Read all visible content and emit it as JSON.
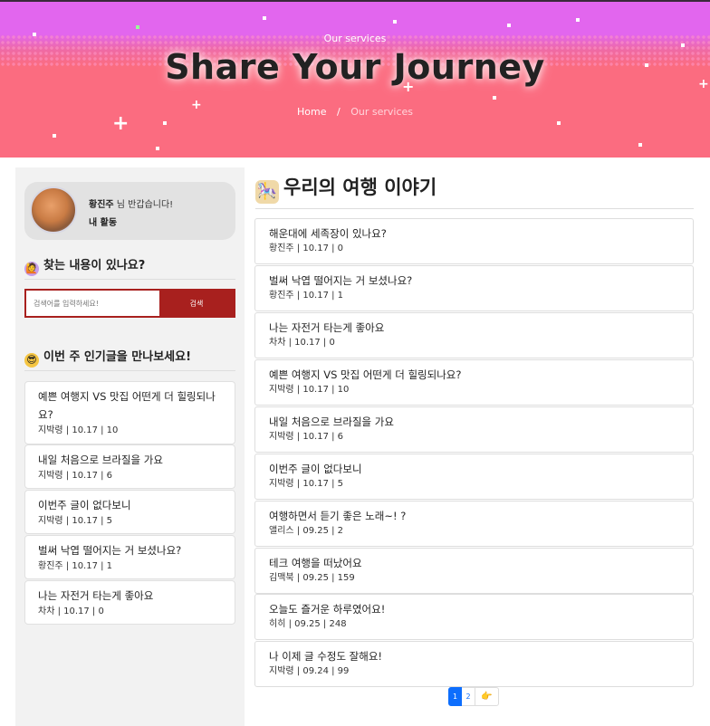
{
  "hero": {
    "eyebrow": "Our services",
    "title": "Share Your Journey",
    "breadcrumb_home": "Home",
    "breadcrumb_sep": "/",
    "breadcrumb_current": "Our services"
  },
  "profile": {
    "name": "황진주",
    "greeting_suffix": " 님 반갑습니다!",
    "activity_link": "내 활동"
  },
  "search": {
    "title": "찾는 내용이 있나요?",
    "placeholder": "검색어를 입력하세요!",
    "button": "검색"
  },
  "popular": {
    "title": "이번 주 인기글을 만나보세요!",
    "items": [
      {
        "title": "예쁜 여행지 VS 맛집 어떤게 더 힐링되나요?",
        "meta": "지박령 | 10.17 | 10"
      },
      {
        "title": "내일 처음으로 브라질을 가요",
        "meta": "지박령 | 10.17 | 6"
      },
      {
        "title": "이번주 글이 없다보니",
        "meta": "지박령 | 10.17 | 5"
      },
      {
        "title": "벌써 낙엽 떨어지는 거 보셨나요?",
        "meta": "황진주 | 10.17 | 1"
      },
      {
        "title": "나는 자전거 타는게 좋아요",
        "meta": "차차 | 10.17 | 0"
      }
    ]
  },
  "main": {
    "title": "우리의 여행 이야기",
    "posts": [
      {
        "title": "해운대에 세족장이 있나요?",
        "meta": "황진주 | 10.17 | 0"
      },
      {
        "title": "벌써 낙엽 떨어지는 거 보셨나요?",
        "meta": "황진주 | 10.17 | 1"
      },
      {
        "title": "나는 자전거 타는게 좋아요",
        "meta": "차차 | 10.17 | 0"
      },
      {
        "title": "예쁜 여행지 VS 맛집 어떤게 더 힐링되나요?",
        "meta": "지박령 | 10.17 | 10"
      },
      {
        "title": "내일 처음으로 브라질을 가요",
        "meta": "지박령 | 10.17 | 6"
      },
      {
        "title": "이번주 글이 없다보니",
        "meta": "지박령 | 10.17 | 5"
      },
      {
        "title": "여행하면서 듣기 좋은 노래~! ?",
        "meta": "앨리스 | 09.25 | 2"
      },
      {
        "title": "테크 여행을 떠났어요",
        "meta": "김맥북 | 09.25 | 159"
      },
      {
        "title": "오늘도 즐거운 하루였어요!",
        "meta": "히히 | 09.25 | 248"
      },
      {
        "title": "나 이제 글 수정도 잘해요!",
        "meta": "지박령 | 09.24 | 99"
      }
    ]
  },
  "pagination": {
    "pages": [
      "1",
      "2"
    ],
    "active": "1",
    "next_icon": "pointing-hand-icon",
    "next_glyph": "👉"
  },
  "colors": {
    "hero_top": "#e266ee",
    "hero_bottom": "#fb6c80",
    "search_accent": "#a8201e",
    "pager_active": "#0d6efd"
  }
}
